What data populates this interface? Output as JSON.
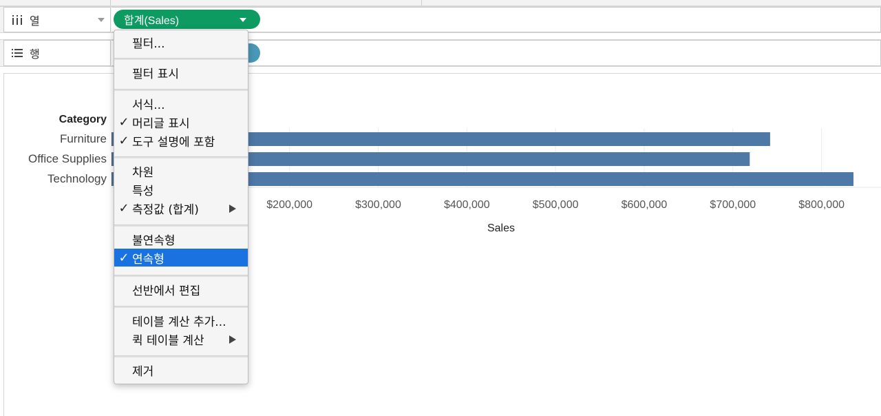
{
  "shelves": {
    "columns": {
      "label": "열",
      "pill": "합계(Sales)"
    },
    "rows": {
      "label": "행"
    }
  },
  "colors": {
    "bar": "#4e79a7",
    "pill_green": "#0d9b62",
    "pill_teal": "#4a98b8",
    "menu_highlight": "#1a72e0"
  },
  "chart_data": {
    "type": "bar",
    "orientation": "horizontal",
    "row_header": "Category",
    "categories": [
      "Furniture",
      "Office Supplies",
      "Technology"
    ],
    "values": [
      742000,
      719000,
      836000
    ],
    "xlabel": "Sales",
    "x_ticks": [
      "$200,000",
      "$300,000",
      "$400,000",
      "$500,000",
      "$600,000",
      "$700,000",
      "$800,000"
    ],
    "x_tick_values": [
      200000,
      300000,
      400000,
      500000,
      600000,
      700000,
      800000
    ],
    "xlim": [
      0,
      836000
    ],
    "grid": true
  },
  "context_menu": {
    "groups": [
      [
        {
          "label": "필터...",
          "checked": false
        }
      ],
      [
        {
          "label": "필터 표시",
          "checked": false
        }
      ],
      [
        {
          "label": "서식...",
          "checked": false
        },
        {
          "label": "머리글 표시",
          "checked": true
        },
        {
          "label": "도구 설명에 포함",
          "checked": true
        }
      ],
      [
        {
          "label": "차원",
          "checked": false
        },
        {
          "label": "특성",
          "checked": false
        },
        {
          "label": "측정값 (합계)",
          "checked": true,
          "submenu": true
        }
      ],
      [
        {
          "label": "불연속형",
          "checked": false
        },
        {
          "label": "연속형",
          "checked": true,
          "selected": true
        }
      ],
      [
        {
          "label": "선반에서 편집",
          "checked": false
        }
      ],
      [
        {
          "label": "테이블 계산 추가...",
          "checked": false
        },
        {
          "label": "퀵 테이블 계산",
          "checked": false,
          "submenu": true
        }
      ],
      [
        {
          "label": "제거",
          "checked": false
        }
      ]
    ]
  }
}
